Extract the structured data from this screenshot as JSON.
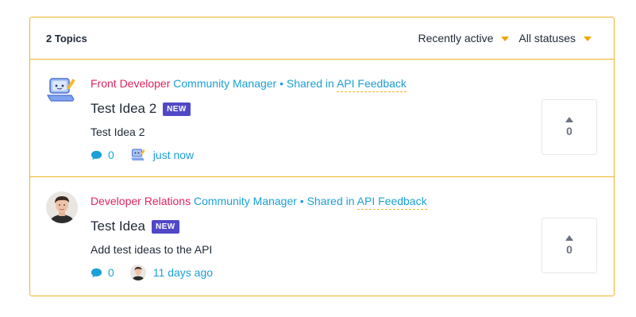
{
  "header": {
    "topic_count": "2 Topics",
    "sort_label": "Recently active",
    "status_label": "All statuses"
  },
  "topics": [
    {
      "author_role": "Front Developer",
      "author_title": "Community Manager",
      "shared_text": "• Shared in",
      "category": "API Feedback",
      "title": "Test Idea 2",
      "badge": "NEW",
      "excerpt": "Test Idea 2",
      "comments": "0",
      "time": "just now",
      "votes": "0",
      "avatar": "laptop-mascot-avatar"
    },
    {
      "author_role": "Developer Relations",
      "author_title": "Community Manager",
      "shared_text": "• Shared in",
      "category": "API Feedback",
      "title": "Test Idea",
      "badge": "NEW",
      "excerpt": "Add test ideas to the API",
      "comments": "0",
      "time": "11 days ago",
      "votes": "0",
      "avatar": "person-photo-avatar"
    }
  ],
  "colors": {
    "accent_border": "#f0b429",
    "role": "#e0245e",
    "link": "#1ba0d7",
    "badge": "#5048c8"
  }
}
